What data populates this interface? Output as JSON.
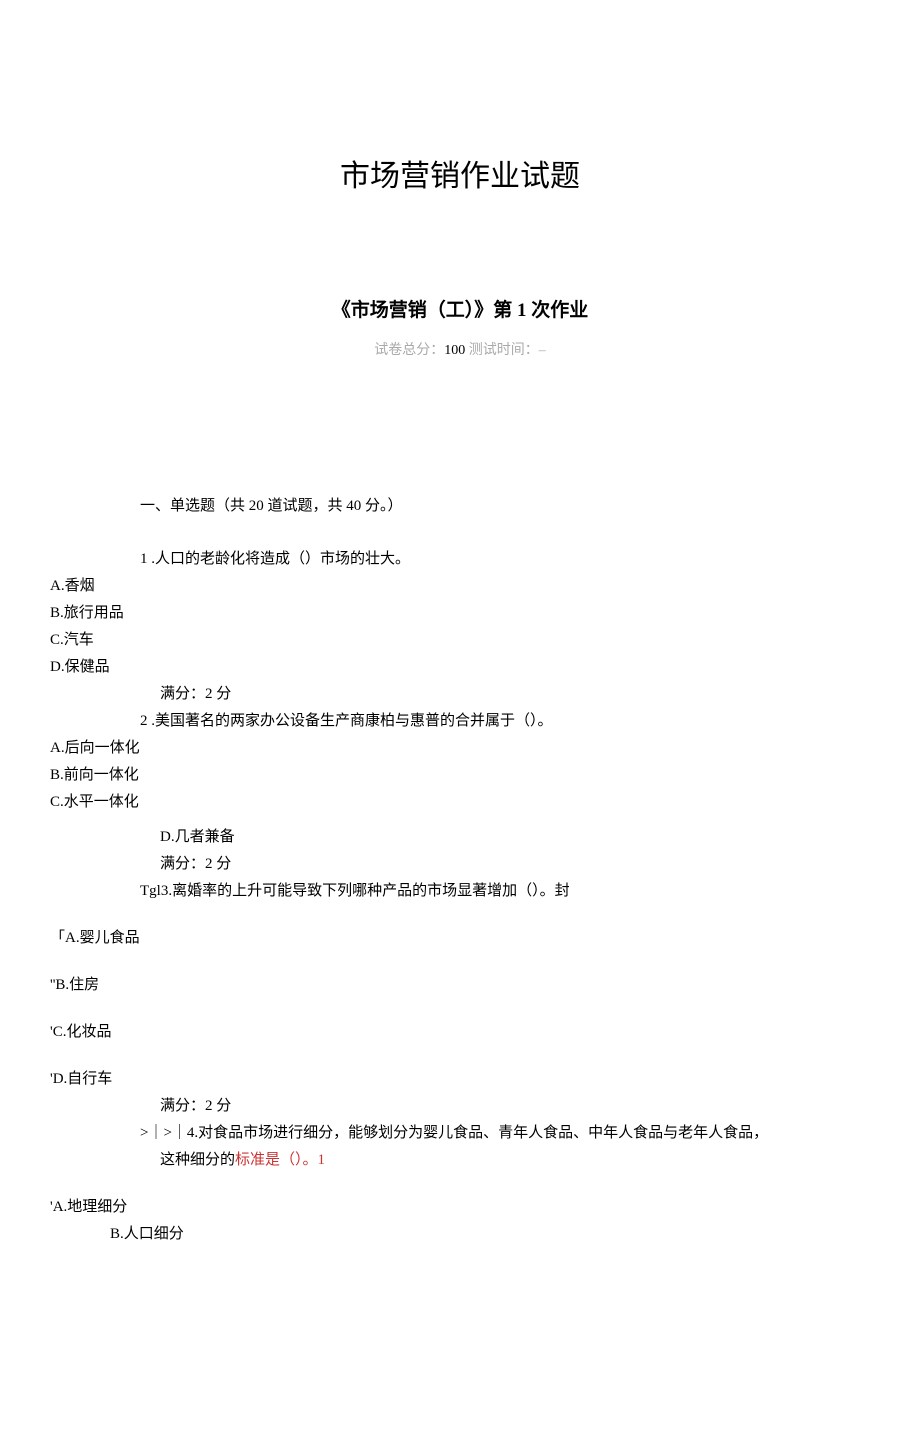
{
  "mainTitle": "市场营销作业试题",
  "subTitle": "《市场营销（工）》第 1 次作业",
  "metaPrefix": "试卷总分：",
  "metaTotal": "100",
  "metaSep": "       ",
  "metaTimeLabel": "测试时间：–",
  "section1": "一、单选题（共 20 道试题，共 40 分。）",
  "q1": {
    "stem": "1 .人口的老龄化将造成（）市场的壮大。",
    "a": "A.香烟",
    "b": "B.旅行用品",
    "c": "C.汽车",
    "d": "D.保健品",
    "score": "满分：2 分"
  },
  "q2": {
    "stem": "2 .美国著名的两家办公设备生产商康柏与惠普的合并属于（）。",
    "a": "A.后向一体化",
    "b": "B.前向一体化",
    "c": "C.水平一体化",
    "d": "D.几者兼备",
    "score": "满分：2 分"
  },
  "q3": {
    "stem": "Tgl3.离婚率的上升可能导致下列哪种产品的市场显著增加（）。封",
    "a": "「A.婴儿食品",
    "b": "''B.住房",
    "c": "'C.化妆品",
    "d": "'D.自行车",
    "score": "满分：2 分"
  },
  "q4": {
    "stem1": ">｜>｜4.对食品市场进行细分，能够划分为婴儿食品、青年人食品、中年人食品与老年人食品，",
    "stem2a": "这种细分的",
    "stem2b": "标准是（）。1",
    "a": "'A.地理细分",
    "b": "B.人口细分"
  }
}
